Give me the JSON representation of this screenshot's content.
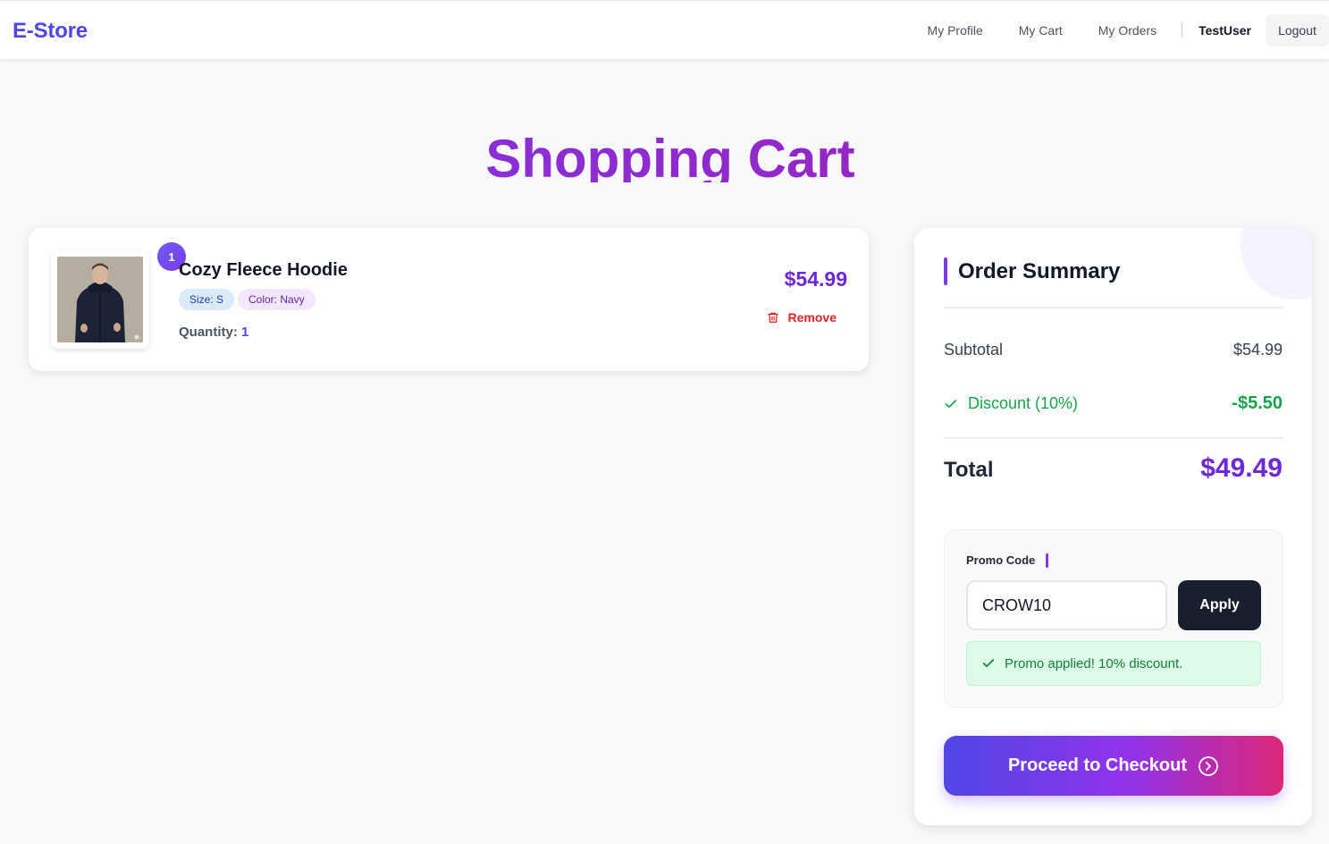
{
  "header": {
    "logo": "E-Store",
    "nav": {
      "profile": "My Profile",
      "cart": "My Cart",
      "orders": "My Orders"
    },
    "user": "TestUser",
    "logout": "Logout"
  },
  "page": {
    "title": "Shopping Cart"
  },
  "cart": {
    "items": [
      {
        "index_badge": "1",
        "name": "Cozy Fleece Hoodie",
        "size": "Size: S",
        "color": "Color: Navy",
        "quantity_label": "Quantity:",
        "quantity": "1",
        "price": "$54.99",
        "remove_label": "Remove",
        "icon": "trash-icon"
      }
    ]
  },
  "summary": {
    "title": "Order Summary",
    "subtotal_label": "Subtotal",
    "subtotal": "$54.99",
    "discount_label": "Discount (10%)",
    "discount": "-$5.50",
    "total_label": "Total",
    "total": "$49.49",
    "promo": {
      "label": "Promo Code",
      "value": "CROW10",
      "apply_label": "Apply",
      "message": "Promo applied! 10% discount."
    },
    "checkout_label": "Proceed to Checkout"
  },
  "colors": {
    "brand": "#4f46e5",
    "accent": "#7c3aed",
    "success": "#16a34a",
    "danger": "#dc2626"
  }
}
